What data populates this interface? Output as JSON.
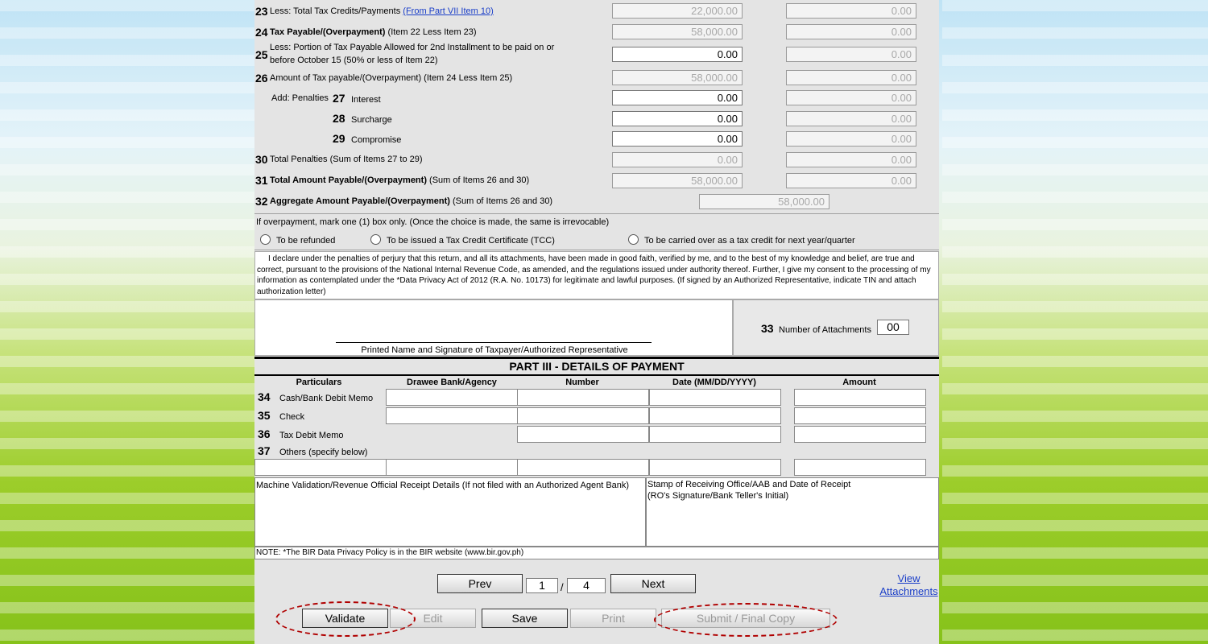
{
  "rows": {
    "r23": {
      "num": "23",
      "label": "Less: Total Tax Credits/Payments ",
      "link": "(From Part VII Item 10)",
      "v1": "22,000.00",
      "v2": "0.00"
    },
    "r24": {
      "num": "24",
      "label_bold": "Tax Payable/(Overpayment)",
      "label": " (Item 22 Less Item 23)",
      "v1": "58,000.00",
      "v2": "0.00"
    },
    "r25": {
      "num": "25",
      "label_line1": "Less: Portion of Tax Payable Allowed for 2nd Installment to be paid on or",
      "label_line2": "before October 15 (50% or less of Item 22)",
      "v1": "0.00",
      "v2": "0.00"
    },
    "r26": {
      "num": "26",
      "label": "Amount of Tax payable/(Overpayment) (Item 24 Less Item 25)",
      "v1": "58,000.00",
      "v2": "0.00"
    },
    "r27": {
      "prefix": "Add: Penalties",
      "num": "27",
      "label": "Interest",
      "v1": "0.00",
      "v2": "0.00"
    },
    "r28": {
      "num": "28",
      "label": "Surcharge",
      "v1": "0.00",
      "v2": "0.00"
    },
    "r29": {
      "num": "29",
      "label": "Compromise",
      "v1": "0.00",
      "v2": "0.00"
    },
    "r30": {
      "num": "30",
      "label": "Total Penalties (Sum of Items 27 to 29)",
      "v1": "0.00",
      "v2": "0.00"
    },
    "r31": {
      "num": "31",
      "label_bold": "Total Amount Payable/(Overpayment)",
      "label": " (Sum of Items 26 and 30)",
      "v1": "58,000.00",
      "v2": "0.00"
    },
    "r32": {
      "num": "32",
      "label_bold": "Aggregate Amount Payable/(Overpayment)",
      "label": " (Sum of Items 26 and 30)",
      "v": "58,000.00"
    }
  },
  "overpayment": {
    "note": "If overpayment, mark one (1) box only. (Once the choice is made, the same is irrevocable)",
    "opt1": "To be refunded",
    "opt2": "To be issued a Tax Credit Certificate (TCC)",
    "opt3": "To be carried over as a tax credit for next year/quarter"
  },
  "declaration": "I declare under the penalties of perjury that this return, and all its attachments, have been made in good faith, verified by me, and to the best of my knowledge and belief, are true and correct, pursuant to the provisions of the National Internal Revenue Code, as amended, and the regulations issued under authority thereof. Further, I give my consent to the processing of my information as contemplated under the *Data Privacy Act of 2012 (R.A. No. 10173) for legitimate and lawful purposes. (If signed by an Authorized Representative, indicate TIN and attach authorization letter)",
  "signature_label": "Printed Name and Signature of Taxpayer/Authorized Representative",
  "attachments": {
    "num": "33",
    "label": "Number of Attachments",
    "value": "00"
  },
  "part3": {
    "title": "PART III - DETAILS OF PAYMENT",
    "headers": {
      "particulars": "Particulars",
      "bank": "Drawee Bank/Agency",
      "number": "Number",
      "date": "Date (MM/DD/YYYY)",
      "amount": "Amount"
    },
    "r34": {
      "num": "34",
      "label": "Cash/Bank Debit Memo"
    },
    "r35": {
      "num": "35",
      "label": "Check"
    },
    "r36": {
      "num": "36",
      "label": "Tax Debit Memo"
    },
    "r37": {
      "num": "37",
      "label": "Others (specify below)"
    }
  },
  "validation_label": "Machine Validation/Revenue Official Receipt Details (If not filed with an Authorized Agent Bank)",
  "stamp_label_1": "Stamp of Receiving Office/AAB and Date of Receipt",
  "stamp_label_2": "(RO's Signature/Bank Teller's Initial)",
  "note": "NOTE: *The BIR Data Privacy Policy is in the BIR website (www.bir.gov.ph)",
  "nav": {
    "prev": "Prev",
    "page": "1",
    "slash": "/",
    "total": "4",
    "next": "Next",
    "view_attachments_1": "View",
    "view_attachments_2": "Attachments"
  },
  "actions": {
    "validate": "Validate",
    "edit": "Edit",
    "save": "Save",
    "print": "Print",
    "submit": "Submit / Final Copy"
  }
}
